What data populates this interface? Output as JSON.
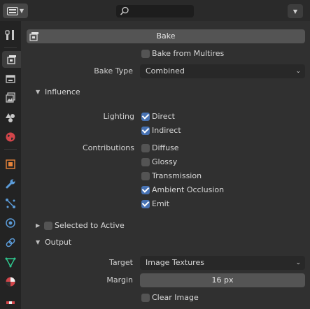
{
  "header": {
    "editor_type_icon": "properties-editor-icon",
    "search_icon": "search-icon",
    "options_icon": "chevron-down-icon"
  },
  "sidebar": {
    "tabs": [
      {
        "name": "tool",
        "icon": "tool-icon"
      },
      {
        "name": "render",
        "icon": "render-icon",
        "active": true
      },
      {
        "name": "output",
        "icon": "output-icon"
      },
      {
        "name": "view-layer",
        "icon": "view-layer-icon"
      },
      {
        "name": "scene",
        "icon": "scene-icon"
      },
      {
        "name": "world",
        "icon": "world-icon"
      },
      {
        "name": "object",
        "icon": "object-icon"
      },
      {
        "name": "modifiers",
        "icon": "wrench-icon"
      },
      {
        "name": "particles",
        "icon": "particles-icon"
      },
      {
        "name": "physics",
        "icon": "physics-icon"
      },
      {
        "name": "constraints",
        "icon": "constraints-icon"
      },
      {
        "name": "data",
        "icon": "mesh-data-icon"
      },
      {
        "name": "material",
        "icon": "material-icon"
      },
      {
        "name": "texture",
        "icon": "texture-icon"
      }
    ]
  },
  "bake": {
    "button_label": "Bake",
    "bake_from_multires": {
      "label": "Bake from Multires",
      "checked": false
    },
    "bake_type": {
      "label": "Bake Type",
      "value": "Combined"
    }
  },
  "influence": {
    "title": "Influence",
    "lighting_label": "Lighting",
    "direct": {
      "label": "Direct",
      "checked": true
    },
    "indirect": {
      "label": "Indirect",
      "checked": true
    },
    "contributions_label": "Contributions",
    "diffuse": {
      "label": "Diffuse",
      "checked": false
    },
    "glossy": {
      "label": "Glossy",
      "checked": false
    },
    "transmission": {
      "label": "Transmission",
      "checked": false
    },
    "ambient_occlusion": {
      "label": "Ambient Occlusion",
      "checked": true
    },
    "emit": {
      "label": "Emit",
      "checked": true
    }
  },
  "selected_to_active": {
    "label": "Selected to Active",
    "checked": false
  },
  "output": {
    "title": "Output",
    "target": {
      "label": "Target",
      "value": "Image Textures"
    },
    "margin": {
      "label": "Margin",
      "value": "16 px"
    },
    "clear_image": {
      "label": "Clear Image",
      "checked": false
    }
  },
  "colors": {
    "accent": "#4772b3",
    "background": "#303030",
    "sidebar": "#232323"
  }
}
